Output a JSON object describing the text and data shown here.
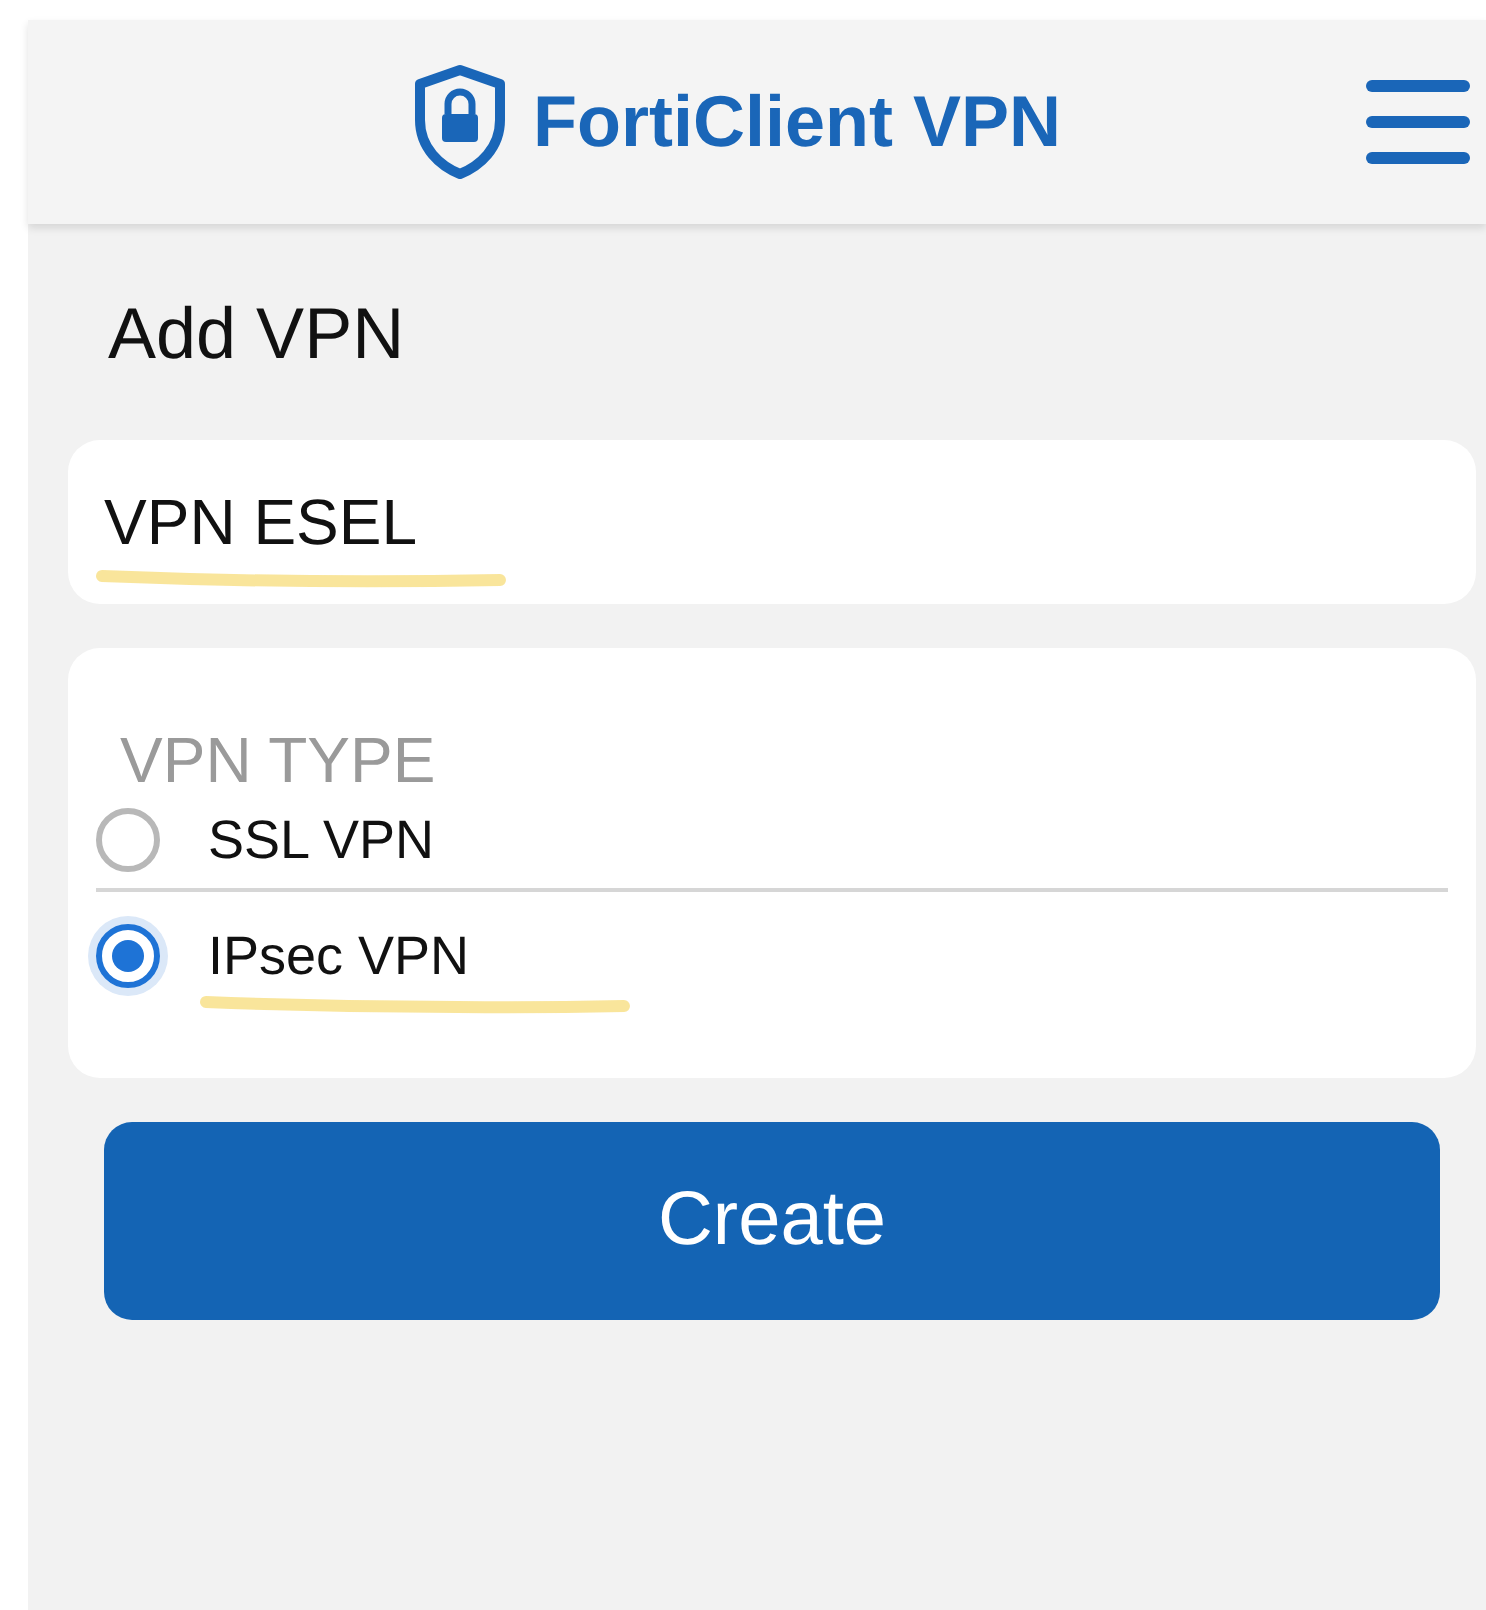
{
  "header": {
    "title": "FortiClient VPN"
  },
  "page_title": "Add VPN",
  "name_field": {
    "value": "VPN ESEL",
    "highlighted": true
  },
  "vpn_type": {
    "label": "VPN TYPE",
    "options": [
      {
        "label": "SSL VPN",
        "selected": false,
        "highlighted": false
      },
      {
        "label": "IPsec VPN",
        "selected": true,
        "highlighted": true
      }
    ]
  },
  "create_button": "Create"
}
